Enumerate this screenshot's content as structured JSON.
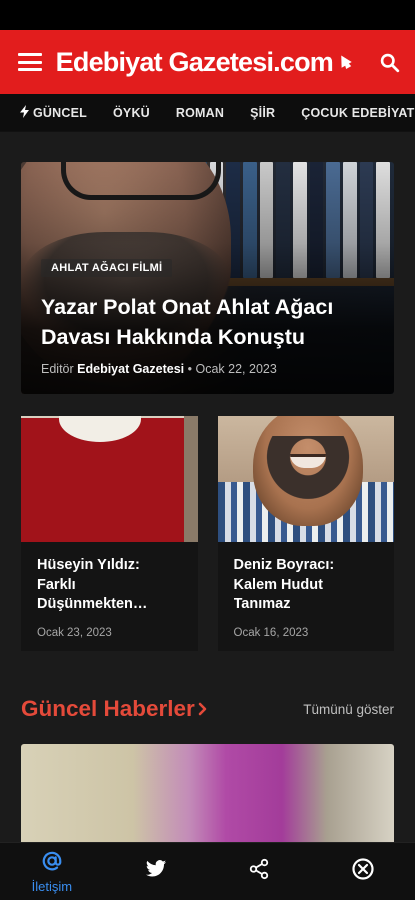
{
  "header": {
    "logo": "Edebiyat Gazetesi.com"
  },
  "categories": [
    {
      "label": "GÜNCEL"
    },
    {
      "label": "ÖYKÜ"
    },
    {
      "label": "ROMAN"
    },
    {
      "label": "ŞİİR"
    },
    {
      "label": "ÇOCUK EDEBİYATI"
    }
  ],
  "hero": {
    "tag": "AHLAT AĞACI FİLMİ",
    "title": "Yazar Polat Onat Ahlat Ağacı Davası Hakkında Konuştu",
    "author_prefix": "Editör",
    "author": "Edebiyat Gazetesi",
    "separator": "•",
    "date": "Ocak 22, 2023"
  },
  "cards": [
    {
      "title": "Hüseyin Yıldız: Farklı Düşünmekten…",
      "date": "Ocak 23, 2023"
    },
    {
      "title": "Deniz Boyracı: Kalem Hudut Tanımaz",
      "date": "Ocak 16, 2023"
    }
  ],
  "section": {
    "title": "Güncel Haberler",
    "see_all": "Tümünü göster"
  },
  "bottom_nav": {
    "contact_label": "İletişim"
  },
  "colors": {
    "brand_red": "#e21d1d",
    "section_red": "#e44a3a",
    "active_blue": "#3a8ef0"
  }
}
